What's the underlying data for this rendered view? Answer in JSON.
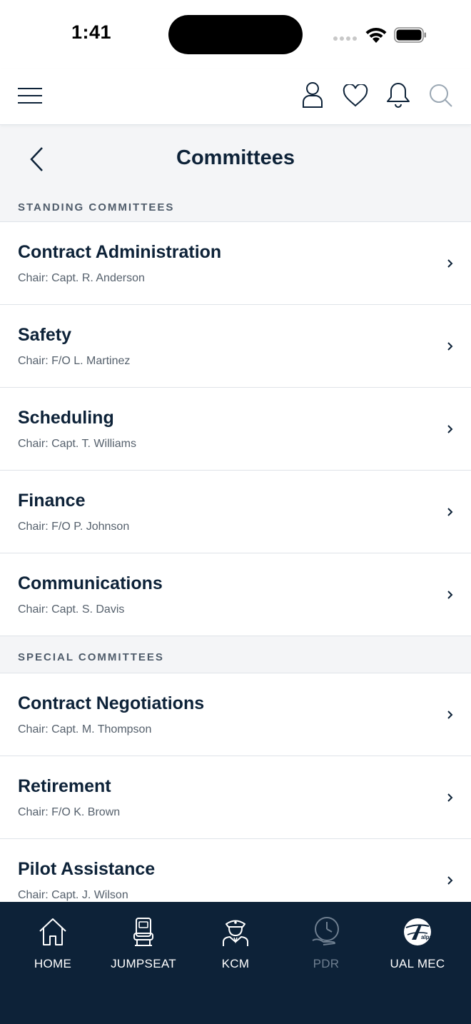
{
  "status_bar": {
    "time": "1:41"
  },
  "header": {
    "menu_icon": "hamburger-menu-icon",
    "profile_icon": "person-icon",
    "favorites_icon": "heart-icon",
    "notifications_icon": "bell-icon",
    "search_icon": "search-icon"
  },
  "page": {
    "title": "Committees",
    "back_icon": "chevron-left-icon"
  },
  "sections": [
    {
      "heading": "STANDING COMMITTEES",
      "items": [
        {
          "name": "Contract Administration",
          "chair": "Chair: Capt. R. Anderson"
        },
        {
          "name": "Safety",
          "chair": "Chair: F/O L. Martinez"
        },
        {
          "name": "Scheduling",
          "chair": "Chair: Capt. T. Williams"
        },
        {
          "name": "Finance",
          "chair": "Chair: F/O P. Johnson"
        },
        {
          "name": "Communications",
          "chair": "Chair: Capt. S. Davis"
        }
      ]
    },
    {
      "heading": "SPECIAL COMMITTEES",
      "items": [
        {
          "name": "Contract Negotiations",
          "chair": "Chair: Capt. M. Thompson"
        },
        {
          "name": "Retirement",
          "chair": "Chair: F/O K. Brown"
        },
        {
          "name": "Pilot Assistance",
          "chair": "Chair: Capt. J. Wilson"
        }
      ]
    }
  ],
  "tab_bar": {
    "tabs": [
      {
        "label": "HOME",
        "icon": "home-icon",
        "enabled": true
      },
      {
        "label": "JUMPSEAT",
        "icon": "seat-icon",
        "enabled": true
      },
      {
        "label": "KCM",
        "icon": "pilot-icon",
        "enabled": true
      },
      {
        "label": "PDR",
        "icon": "clock-hand-icon",
        "enabled": false
      },
      {
        "label": "UAL MEC",
        "icon": "alpa-logo-icon",
        "enabled": true
      }
    ],
    "logo_text": "alpa"
  },
  "colors": {
    "navy": "#0d2238",
    "page_bg": "#f4f5f7",
    "divider": "#dfe3e8",
    "muted_text": "#55606c",
    "disabled_tab": "#6f7f90",
    "search_icon": "#9aa7b3"
  }
}
